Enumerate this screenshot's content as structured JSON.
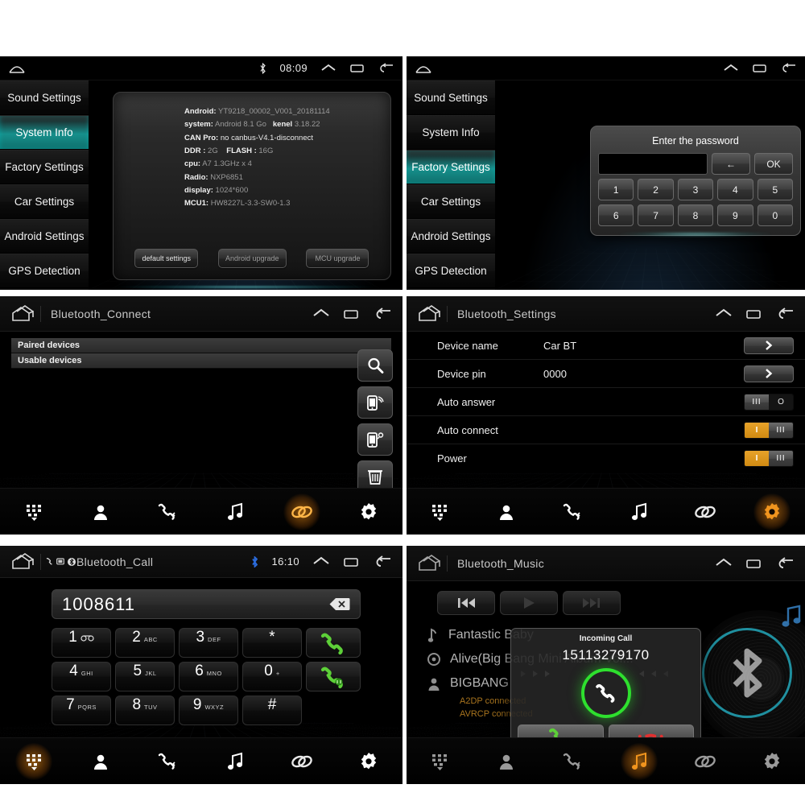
{
  "panels": {
    "system_info": {
      "statusbar": {
        "time": "08:09",
        "bluetooth_icon": "bluetooth-icon"
      },
      "sidebar": [
        {
          "label": "Sound Settings",
          "selected": false
        },
        {
          "label": "System Info",
          "selected": true
        },
        {
          "label": "Factory Settings",
          "selected": false
        },
        {
          "label": "Car Settings",
          "selected": false
        },
        {
          "label": "Android Settings",
          "selected": false
        },
        {
          "label": "GPS Detection",
          "selected": false
        }
      ],
      "info": [
        {
          "key": "Android:",
          "value": "YT9218_00002_V001_20181114"
        },
        {
          "key": "system:",
          "value": "Android 8.1 Go",
          "key2": "kenel",
          "value2": "3.18.22"
        },
        {
          "key": "CAN Pro:",
          "value": "no canbus-V4.1-disconnect",
          "value_bright": true
        },
        {
          "key": "DDR :",
          "value": "2G",
          "key2": "FLASH :",
          "value2": "16G"
        },
        {
          "key": "cpu:",
          "value": "A7 1.3GHz x 4"
        },
        {
          "key": "Radio:",
          "value": "NXP6851"
        },
        {
          "key": "display:",
          "value": "1024*600"
        },
        {
          "key": "MCU1:",
          "value": "HW8227L-3.3-SW0-1.3"
        }
      ],
      "buttons": [
        {
          "label": "default settings",
          "dim": false
        },
        {
          "label": "Android upgrade",
          "dim": true
        },
        {
          "label": "MCU upgrade",
          "dim": true
        }
      ]
    },
    "factory_password": {
      "sidebar": [
        {
          "label": "Sound Settings",
          "selected": false
        },
        {
          "label": "System Info",
          "selected": false
        },
        {
          "label": "Factory Settings",
          "selected": true
        },
        {
          "label": "Car Settings",
          "selected": false
        },
        {
          "label": "Android Settings",
          "selected": false
        },
        {
          "label": "GPS Detection",
          "selected": false
        }
      ],
      "dialog": {
        "title": "Enter the password",
        "input_value": "",
        "backspace_label": "←",
        "ok_label": "OK",
        "keys": [
          "1",
          "2",
          "3",
          "4",
          "5",
          "6",
          "7",
          "8",
          "9",
          "0"
        ]
      }
    },
    "bluetooth_connect": {
      "title": "Bluetooth_Connect",
      "lists": [
        {
          "label": "Paired devices"
        },
        {
          "label": "Usable devices"
        }
      ],
      "side_buttons": [
        {
          "name": "search-icon"
        },
        {
          "name": "phone-connect-icon"
        },
        {
          "name": "phone-search-icon"
        },
        {
          "name": "trash-icon"
        }
      ],
      "active_nav": 4
    },
    "bluetooth_settings": {
      "title": "Bluetooth_Settings",
      "rows": [
        {
          "label": "Device name",
          "value": "Car BT",
          "control": "chevron"
        },
        {
          "label": "Device pin",
          "value": "0000",
          "control": "chevron"
        },
        {
          "label": "Auto answer",
          "value": "",
          "control": "toggle",
          "state": "off"
        },
        {
          "label": "Auto connect",
          "value": "",
          "control": "toggle",
          "state": "on"
        },
        {
          "label": "Power",
          "value": "",
          "control": "toggle",
          "state": "on"
        }
      ],
      "toggle_on_label": "I",
      "toggle_off_label": "O",
      "toggle_knob_label": "III",
      "active_nav": 5
    },
    "bluetooth_call": {
      "title": "Bluetooth_Call",
      "statusbar": {
        "time": "16:10",
        "bluetooth_icon": "bluetooth-icon"
      },
      "number": "1008611",
      "keys": [
        {
          "digit": "1",
          "letters": "∞",
          "icon": "voicemail-icon"
        },
        {
          "digit": "2",
          "letters": "ABC"
        },
        {
          "digit": "3",
          "letters": "DEF"
        },
        {
          "digit": "*",
          "letters": ""
        },
        {
          "digit": "4",
          "letters": "GHI"
        },
        {
          "digit": "5",
          "letters": "JKL"
        },
        {
          "digit": "6",
          "letters": "MNO"
        },
        {
          "digit": "0",
          "letters": "+"
        },
        {
          "digit": "7",
          "letters": "PQRS"
        },
        {
          "digit": "8",
          "letters": "TUV"
        },
        {
          "digit": "9",
          "letters": "WXYZ"
        },
        {
          "digit": "#",
          "letters": ""
        }
      ],
      "call_button": "call-icon",
      "transfer_button": "call-transfer-icon",
      "backspace": "backspace-icon",
      "active_nav": 0
    },
    "bluetooth_music": {
      "title": "Bluetooth_Music",
      "controls": [
        {
          "name": "previous-icon"
        },
        {
          "name": "play-icon"
        },
        {
          "name": "next-icon"
        }
      ],
      "track": "Fantastic Baby",
      "album": "Alive(Big Bang Mini Album Vol...",
      "artist": "BIGBANG",
      "status": [
        "A2DP connected",
        "AVRCP connected"
      ],
      "dialog": {
        "title": "Incoming Call",
        "number": "15113279170",
        "accept_label": "accept-call-icon",
        "reject_label": "reject-call-icon"
      },
      "active_nav": 3
    }
  },
  "nav_items": [
    {
      "name": "dialpad-icon",
      "label": "Dialpad"
    },
    {
      "name": "contacts-icon",
      "label": "Contacts"
    },
    {
      "name": "call-history-icon",
      "label": "Call history"
    },
    {
      "name": "music-icon",
      "label": "Music"
    },
    {
      "name": "bluetooth-link-icon",
      "label": "Connect"
    },
    {
      "name": "settings-gear-icon",
      "label": "Settings"
    }
  ],
  "colors": {
    "accent_amber": "#e8a32a",
    "accent_teal": "#16908c",
    "call_green": "#2ee02e",
    "reject_red": "#e02020",
    "status_amber": "#a8741e"
  }
}
